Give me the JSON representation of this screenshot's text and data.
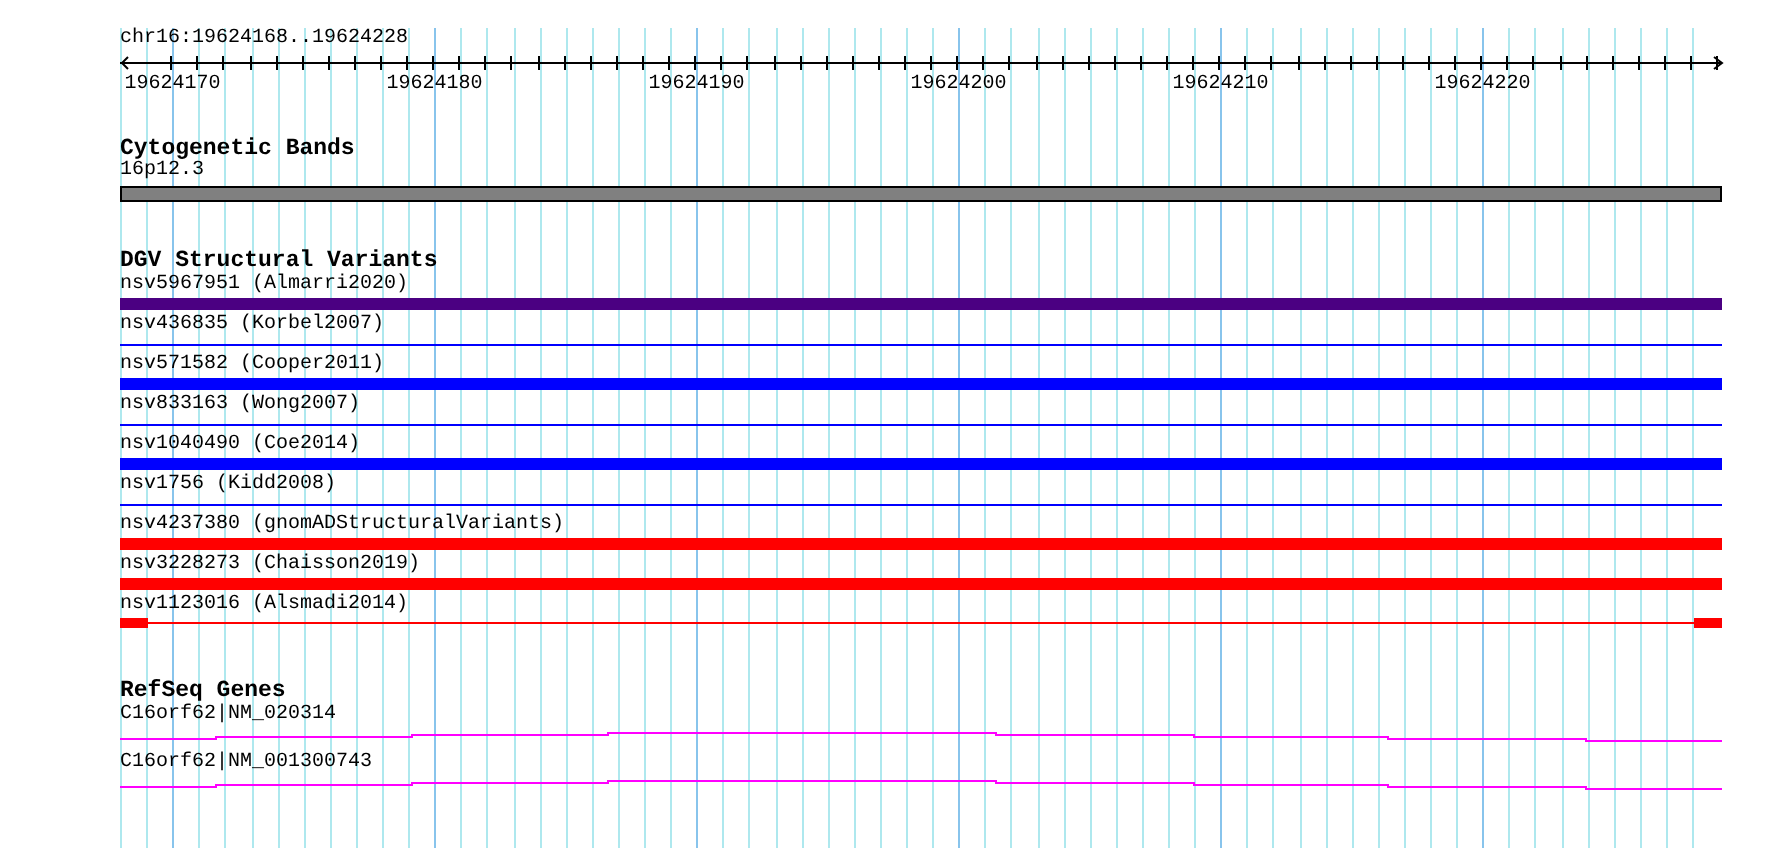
{
  "ruler": {
    "location": "chr16:19624168..19624228",
    "ticks": [
      "19624170",
      "19624180",
      "19624190",
      "19624200",
      "19624210",
      "19624220"
    ]
  },
  "tracks": [
    {
      "title": "Cytogenetic Bands",
      "features": [
        {
          "label": "16p12.3",
          "kind": "band",
          "color": "#808080"
        }
      ]
    },
    {
      "title": "DGV Structural Variants",
      "features": [
        {
          "label": "nsv5967951 (Almarri2020)",
          "kind": "thick",
          "color": "#4b0082"
        },
        {
          "label": "nsv436835 (Korbel2007)",
          "kind": "thin",
          "color": "#0000ff"
        },
        {
          "label": "nsv571582 (Cooper2011)",
          "kind": "thick",
          "color": "#0000ff"
        },
        {
          "label": "nsv833163 (Wong2007)",
          "kind": "thin",
          "color": "#0000ff"
        },
        {
          "label": "nsv1040490 (Coe2014)",
          "kind": "thick",
          "color": "#0000ff"
        },
        {
          "label": "nsv1756 (Kidd2008)",
          "kind": "thin",
          "color": "#0000ff"
        },
        {
          "label": "nsv4237380 (gnomADStructuralVariants)",
          "kind": "thick",
          "color": "#ff0000"
        },
        {
          "label": "nsv3228273 (Chaisson2019)",
          "kind": "thick",
          "color": "#ff0000"
        },
        {
          "label": "nsv1123016 (Alsmadi2014)",
          "kind": "ends",
          "color": "#ff0000"
        }
      ]
    },
    {
      "title": "RefSeq Genes",
      "features": [
        {
          "label": "C16orf62|NM_020314",
          "kind": "gene",
          "color": "#ff00ff"
        },
        {
          "label": "C16orf62|NM_001300743",
          "kind": "gene",
          "color": "#ff00ff"
        }
      ]
    }
  ]
}
